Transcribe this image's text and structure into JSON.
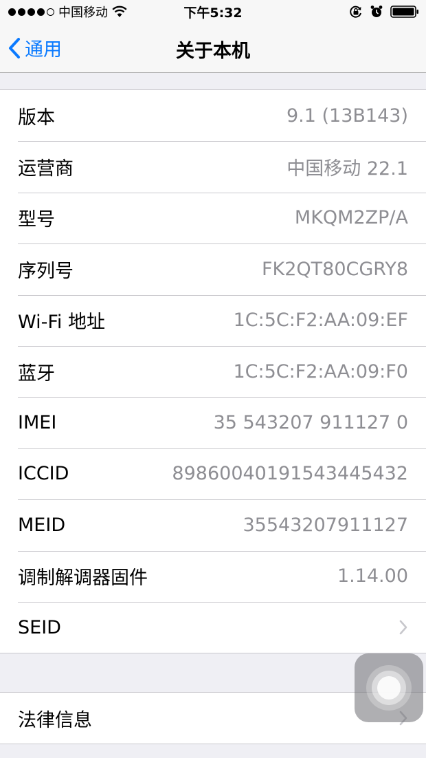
{
  "status_bar": {
    "signal_dots": 5,
    "signal_filled": 4,
    "carrier": "中国移动",
    "time": "下午5:32",
    "icons": [
      "wifi-icon",
      "rotation-lock-icon",
      "alarm-icon",
      "battery-icon"
    ]
  },
  "nav": {
    "back_label": "通用",
    "title": "关于本机"
  },
  "rows": [
    {
      "label": "版本",
      "value": "9.1 (13B143)"
    },
    {
      "label": "运营商",
      "value": "中国移动 22.1"
    },
    {
      "label": "型号",
      "value": "MKQM2ZP/A"
    },
    {
      "label": "序列号",
      "value": "FK2QT80CGRY8"
    },
    {
      "label": "Wi-Fi 地址",
      "value": "1C:5C:F2:AA:09:EF"
    },
    {
      "label": "蓝牙",
      "value": "1C:5C:F2:AA:09:F0"
    },
    {
      "label": "IMEI",
      "value": "35 543207 911127 0"
    },
    {
      "label": "ICCID",
      "value": "89860040191543445432"
    },
    {
      "label": "MEID",
      "value": "35543207911127"
    },
    {
      "label": "调制解调器固件",
      "value": "1.14.00"
    },
    {
      "label": "SEID",
      "value": ""
    }
  ],
  "section2": {
    "legal_label": "法律信息"
  },
  "colors": {
    "accent": "#0a7aff",
    "value_text": "#8e8e93",
    "background": "#efeff4"
  }
}
